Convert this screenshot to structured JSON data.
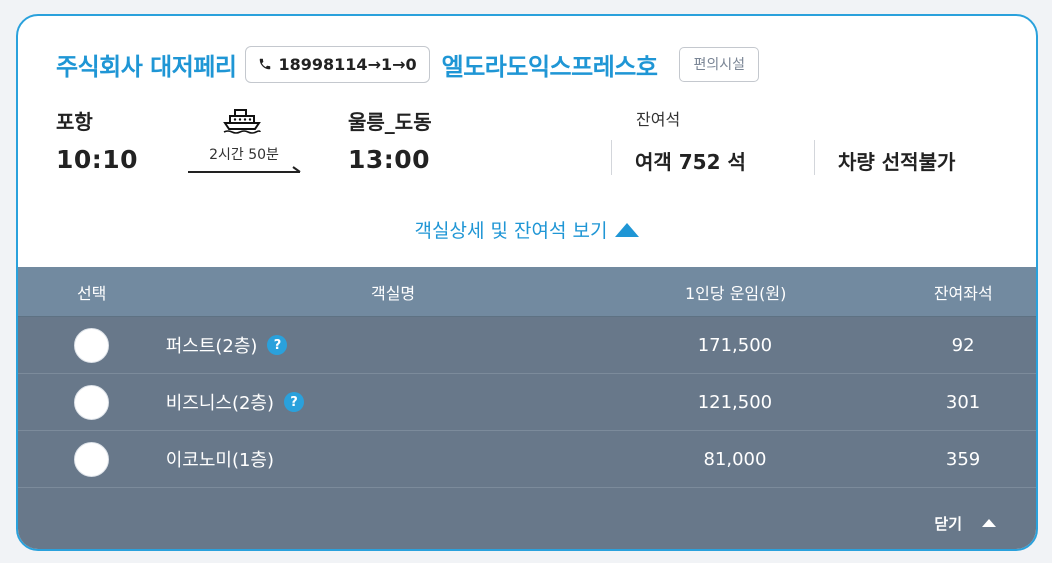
{
  "header": {
    "company": "주식회사 대저페리",
    "phone_route": "18998114→1→0",
    "ship": "엘도라도익스프레스호",
    "amenities_label": "편의시설"
  },
  "route": {
    "depart_port": "포항",
    "depart_time": "10:10",
    "duration": "2시간 50분",
    "arrive_port": "울릉_도동",
    "arrive_time": "13:00"
  },
  "availability": {
    "label": "잔여석",
    "passenger": "여객 752 석",
    "vehicle": "차량 선적불가"
  },
  "toggle_label": "객실상세 및 잔여석 보기",
  "table": {
    "headers": {
      "select": "선택",
      "name": "객실명",
      "fare": "1인당 운임(원)",
      "seats": "잔여좌석"
    },
    "rows": [
      {
        "name": "퍼스트(2층)",
        "help": "?",
        "fare": "171,500",
        "seats": "92"
      },
      {
        "name": "비즈니스(2층)",
        "help": "?",
        "fare": "121,500",
        "seats": "301"
      },
      {
        "name": "이코노미(1층)",
        "fare": "81,000",
        "seats": "359"
      }
    ]
  },
  "close_label": "닫기",
  "colors": {
    "accent": "#1f96d5",
    "table_header": "#728aa0",
    "table_body": "#68788a"
  }
}
